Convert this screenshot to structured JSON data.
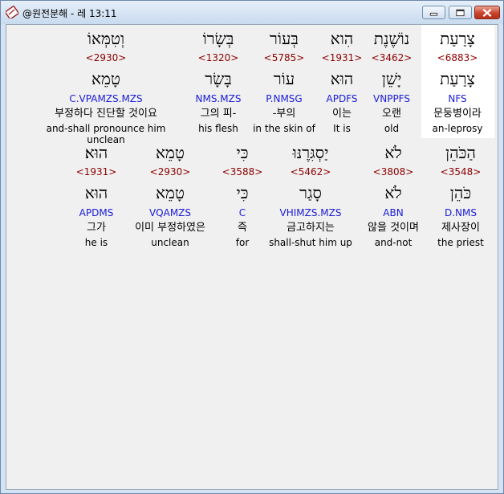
{
  "window": {
    "title": "@원전분해 - 레 13:11"
  },
  "verse_rows": [
    {
      "words": [
        {
          "hebrew": "צָרַעַת",
          "strong": "<6883>",
          "lemma": "צָרַעַת",
          "morph": "NFS",
          "korean": "문둥병이라",
          "english": "an-leprosy"
        },
        {
          "hebrew": "נוֹשֶׁנֶת",
          "strong": "<3462>",
          "lemma": "יָשֵׁן",
          "morph": "VNPPFS",
          "korean": "오랜",
          "english": "old"
        },
        {
          "hebrew": "הִוא",
          "strong": "<1931>",
          "lemma": "הוּא",
          "morph": "APDFS",
          "korean": "이는",
          "english": "It is"
        },
        {
          "hebrew": "בְּעוֹר",
          "strong": "<5785>",
          "lemma": "עוֹר",
          "morph": "P.NMSG",
          "korean": "-부의",
          "english": "in the skin of"
        },
        {
          "hebrew": "בְּשָׂרוֹ",
          "strong": "<1320>",
          "lemma": "בָּשָׂר",
          "morph": "NMS.MZS",
          "korean": "그의 피-",
          "english": "his flesh"
        },
        {
          "hebrew": "וְטִמְּאוֹ",
          "strong": "<2930>",
          "lemma": "טָמֵא",
          "morph": "C.VPAMZS.MZS",
          "korean": "부정하다 진단할 것이요",
          "english": "and-shall pronounce him unclean"
        }
      ]
    },
    {
      "words": [
        {
          "hebrew": "הַכֹּהֵן",
          "strong": "<3548>",
          "lemma": "כֹּהֵן",
          "morph": "D.NMS",
          "korean": "제사장이",
          "english": "the priest"
        },
        {
          "hebrew": "לֹא",
          "strong": "<3808>",
          "lemma": "לֹא",
          "morph": "ABN",
          "korean": "않을 것이며",
          "english": "and-not"
        },
        {
          "hebrew": "יַסְגִּרֶנּוּ",
          "strong": "<5462>",
          "lemma": "סָגַר",
          "morph": "VHIMZS.MZS",
          "korean": "금고하지는",
          "english": "shall-shut him up"
        },
        {
          "hebrew": "כִּי",
          "strong": "<3588>",
          "lemma": "כִּי",
          "morph": "C",
          "korean": "즉",
          "english": "for"
        },
        {
          "hebrew": "טָמֵא",
          "strong": "<2930>",
          "lemma": "טָמֵא",
          "morph": "VQAMZS",
          "korean": "이미 부정하였은",
          "english": "unclean"
        },
        {
          "hebrew": "הוּא׃",
          "strong": "<1931>",
          "lemma": "הוּא",
          "morph": "APDMS",
          "korean": "그가",
          "english": "he is"
        }
      ]
    }
  ],
  "colors": {
    "strong": "#8b0000",
    "morph": "#1b1bd6",
    "selected_bg": "#ffffff"
  }
}
